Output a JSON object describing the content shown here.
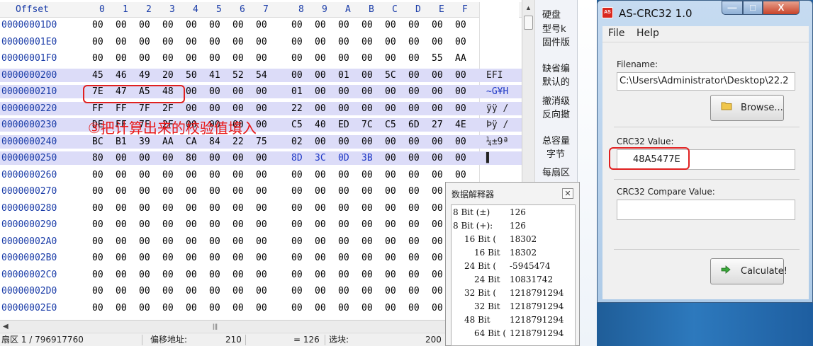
{
  "hex_editor": {
    "header": {
      "offset": "Offset",
      "columns": [
        "0",
        "1",
        "2",
        "3",
        "4",
        "5",
        "6",
        "7",
        "8",
        "9",
        "A",
        "B",
        "C",
        "D",
        "E",
        "F"
      ],
      "corner_icon": "diagonal-arrow-icon"
    },
    "rows": [
      {
        "offset": "00000001D0",
        "bytes": [
          "00",
          "00",
          "00",
          "00",
          "00",
          "00",
          "00",
          "00",
          "00",
          "00",
          "00",
          "00",
          "00",
          "00",
          "00",
          "00"
        ],
        "ascii": ""
      },
      {
        "offset": "00000001E0",
        "bytes": [
          "00",
          "00",
          "00",
          "00",
          "00",
          "00",
          "00",
          "00",
          "00",
          "00",
          "00",
          "00",
          "00",
          "00",
          "00",
          "00"
        ],
        "ascii": ""
      },
      {
        "offset": "00000001F0",
        "bytes": [
          "00",
          "00",
          "00",
          "00",
          "00",
          "00",
          "00",
          "00",
          "00",
          "00",
          "00",
          "00",
          "00",
          "00",
          "55",
          "AA"
        ],
        "ascii": ""
      },
      {
        "offset": "0000000200",
        "bytes": [
          "45",
          "46",
          "49",
          "20",
          "50",
          "41",
          "52",
          "54",
          "00",
          "00",
          "01",
          "00",
          "5C",
          "00",
          "00",
          "00"
        ],
        "ascii": "EFI"
      },
      {
        "offset": "0000000210",
        "bytes": [
          "7E",
          "47",
          "A5",
          "48",
          "00",
          "00",
          "00",
          "00",
          "01",
          "00",
          "00",
          "00",
          "00",
          "00",
          "00",
          "00"
        ],
        "ascii": "~G¥H"
      },
      {
        "offset": "0000000220",
        "bytes": [
          "FF",
          "FF",
          "7F",
          "2F",
          "00",
          "00",
          "00",
          "00",
          "22",
          "00",
          "00",
          "00",
          "00",
          "00",
          "00",
          "00"
        ],
        "ascii": "ÿÿ /"
      },
      {
        "offset": "0000000230",
        "bytes": [
          "DE",
          "FF",
          "7F",
          "2F",
          "00",
          "00",
          "00",
          "00",
          "C5",
          "40",
          "ED",
          "7C",
          "C5",
          "6D",
          "27",
          "4E"
        ],
        "ascii": "Þÿ /"
      },
      {
        "offset": "0000000240",
        "bytes": [
          "BC",
          "B1",
          "39",
          "AA",
          "CA",
          "84",
          "22",
          "75",
          "02",
          "00",
          "00",
          "00",
          "00",
          "00",
          "00",
          "00"
        ],
        "ascii": "¼±9ª"
      },
      {
        "offset": "0000000250",
        "bytes": [
          "80",
          "00",
          "00",
          "00",
          "80",
          "00",
          "00",
          "00",
          "8D",
          "3C",
          "0D",
          "3B",
          "00",
          "00",
          "00",
          "00"
        ],
        "ascii": "▌"
      },
      {
        "offset": "0000000260",
        "bytes": [
          "00",
          "00",
          "00",
          "00",
          "00",
          "00",
          "00",
          "00",
          "00",
          "00",
          "00",
          "00",
          "00",
          "00",
          "00",
          "00"
        ],
        "ascii": ""
      },
      {
        "offset": "0000000270",
        "bytes": [
          "00",
          "00",
          "00",
          "00",
          "00",
          "00",
          "00",
          "00",
          "00",
          "00",
          "00",
          "00",
          "00",
          "00",
          "00",
          "00"
        ],
        "ascii": ""
      },
      {
        "offset": "0000000280",
        "bytes": [
          "00",
          "00",
          "00",
          "00",
          "00",
          "00",
          "00",
          "00",
          "00",
          "00",
          "00",
          "00",
          "00",
          "00",
          "00",
          "00"
        ],
        "ascii": ""
      },
      {
        "offset": "0000000290",
        "bytes": [
          "00",
          "00",
          "00",
          "00",
          "00",
          "00",
          "00",
          "00",
          "00",
          "00",
          "00",
          "00",
          "00",
          "00",
          "00",
          "00"
        ],
        "ascii": ""
      },
      {
        "offset": "00000002A0",
        "bytes": [
          "00",
          "00",
          "00",
          "00",
          "00",
          "00",
          "00",
          "00",
          "00",
          "00",
          "00",
          "00",
          "00",
          "00",
          "00",
          "00"
        ],
        "ascii": ""
      },
      {
        "offset": "00000002B0",
        "bytes": [
          "00",
          "00",
          "00",
          "00",
          "00",
          "00",
          "00",
          "00",
          "00",
          "00",
          "00",
          "00",
          "00",
          "00",
          "00",
          "00"
        ],
        "ascii": ""
      },
      {
        "offset": "00000002C0",
        "bytes": [
          "00",
          "00",
          "00",
          "00",
          "00",
          "00",
          "00",
          "00",
          "00",
          "00",
          "00",
          "00",
          "00",
          "00",
          "00",
          "00"
        ],
        "ascii": ""
      },
      {
        "offset": "00000002D0",
        "bytes": [
          "00",
          "00",
          "00",
          "00",
          "00",
          "00",
          "00",
          "00",
          "00",
          "00",
          "00",
          "00",
          "00",
          "00",
          "00",
          "00"
        ],
        "ascii": ""
      },
      {
        "offset": "00000002E0",
        "bytes": [
          "00",
          "00",
          "00",
          "00",
          "00",
          "00",
          "00",
          "00",
          "00",
          "00",
          "00",
          "00",
          "00",
          "00",
          "00",
          "00"
        ],
        "ascii": ""
      }
    ],
    "annotation": "③把计算出来的校验值填入"
  },
  "status_bar": {
    "sector": "扇区 1 / 796917760",
    "offset_label": "偏移地址:",
    "offset_value": "210",
    "value": "= 126",
    "selection_label": "选块:",
    "trailing": "200"
  },
  "info_panel": [
    "硬盘",
    "型号k",
    "固件版",
    "缺省编",
    "默认的",
    "撤消级",
    "反向撤",
    "总容量",
    "字节",
    "每扇区"
  ],
  "data_interpreter": {
    "title": "数据解释器",
    "close_icon": "close-icon",
    "rows": [
      {
        "label": "8 Bit (±)",
        "value": "126"
      },
      {
        "label": "8 Bit (+):",
        "value": "126"
      },
      {
        "label": "16 Bit (",
        "value": "18302"
      },
      {
        "label": "16 Bit",
        "value": "18302"
      },
      {
        "label": "24 Bit (",
        "value": "-5945474"
      },
      {
        "label": "24 Bit",
        "value": "10831742"
      },
      {
        "label": "32 Bit (",
        "value": "1218791294"
      },
      {
        "label": "32 Bit",
        "value": "1218791294"
      },
      {
        "label": "48 Bit",
        "value": "1218791294"
      },
      {
        "label": "64 Bit (",
        "value": "1218791294"
      }
    ]
  },
  "crc_window": {
    "title": "AS-CRC32 1.0",
    "app_icon_text": "AS",
    "menu": [
      "File",
      "Help"
    ],
    "filename_label": "Filename:",
    "filename_value": "C:\\Users\\Administrator\\Desktop\\22.2",
    "browse_label": "Browse...",
    "crc_label": "CRC32 Value:",
    "crc_value": "48A5477E",
    "compare_label": "CRC32 Compare Value:",
    "compare_value": "",
    "calculate_label": "Calculate!",
    "title_buttons": {
      "minimize": "—",
      "maximize": "□",
      "close": "X"
    }
  },
  "colors": {
    "annotation_red": "#e02020",
    "offset_blue": "#1a3ca8",
    "selection": "#dcdcf8",
    "window_chrome": "#aecbe8"
  }
}
